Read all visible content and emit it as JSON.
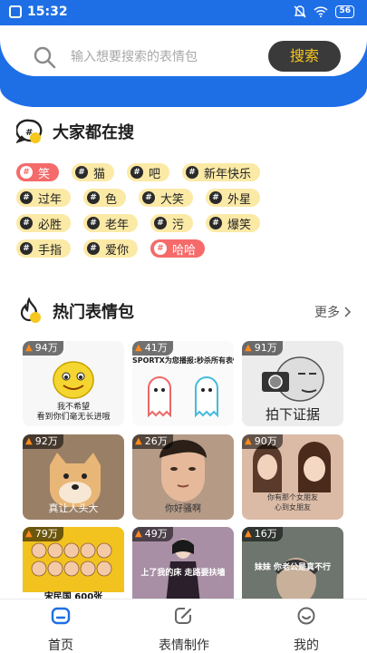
{
  "status_bar": {
    "time": "15:32",
    "battery": "56"
  },
  "search": {
    "placeholder": "输入想要搜索的表情包",
    "value": "",
    "button_label": "搜索"
  },
  "popular_searches": {
    "title": "大家都在搜",
    "tags": [
      [
        {
          "label": "笑",
          "hot": true
        },
        {
          "label": "猫"
        },
        {
          "label": "吧"
        },
        {
          "label": "新年快乐"
        }
      ],
      [
        {
          "label": "过年"
        },
        {
          "label": "色"
        },
        {
          "label": "大笑"
        },
        {
          "label": "外星"
        }
      ],
      [
        {
          "label": "必胜"
        },
        {
          "label": "老年"
        },
        {
          "label": "污"
        },
        {
          "label": "爆笑"
        }
      ],
      [
        {
          "label": "手指"
        },
        {
          "label": "爱你"
        },
        {
          "label": "哈哈",
          "hot": true
        }
      ]
    ]
  },
  "hot_packs": {
    "title": "热门表情包",
    "more_label": "更多",
    "cards": [
      {
        "count": "94万",
        "caption": "我不希望\n看到你们毫无长进哦"
      },
      {
        "count": "41万",
        "caption": "SPORTX为您播报:秒杀所有表情包"
      },
      {
        "count": "91万",
        "caption": "拍下证据"
      },
      {
        "count": "92万",
        "caption": "真让人头大"
      },
      {
        "count": "26万",
        "caption": "你好骚啊"
      },
      {
        "count": "90万",
        "caption": "你有那个女朋友\n心到女朋友"
      },
      {
        "count": "79万",
        "caption": "宋民国 600张"
      },
      {
        "count": "49万",
        "caption": "上了我的床 走路要扶墙"
      },
      {
        "count": "16万",
        "caption": "妹妹 你老公是真不行"
      }
    ]
  },
  "tab_bar": {
    "home": "首页",
    "make": "表情制作",
    "mine": "我的"
  },
  "colors": {
    "primary": "#1e6fe6",
    "tag_bg": "#fbe9a6",
    "tag_hot": "#f56a6a",
    "search_btn_text": "#f6c71e"
  }
}
